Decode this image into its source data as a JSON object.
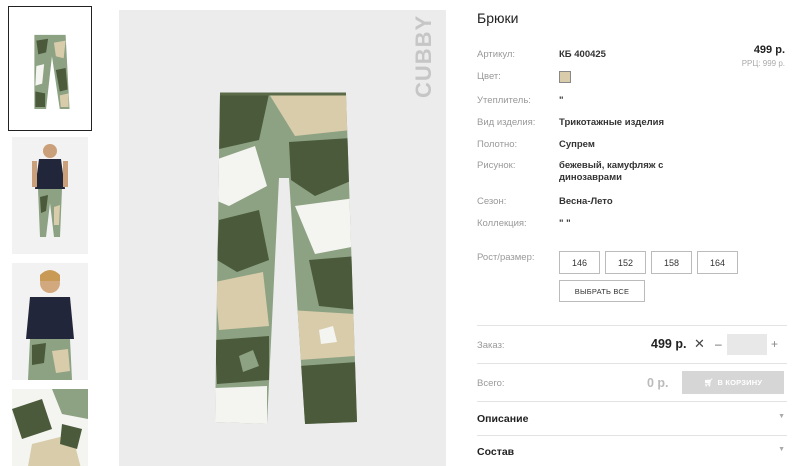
{
  "product": {
    "title": "Брюки",
    "price": "499 р.",
    "rrp": "РРЦ: 999 р.",
    "brand_watermark": "CUBBY"
  },
  "specs": {
    "article": {
      "label": "Артикул:",
      "value": "КБ 400425"
    },
    "color": {
      "label": "Цвет:",
      "swatch_color": "#d8ccaa"
    },
    "insulation": {
      "label": "Утеплитель:",
      "value": "\""
    },
    "type": {
      "label": "Вид изделия:",
      "value": "Трикотажные изделия"
    },
    "fabric": {
      "label": "Полотно:",
      "value": "Супрем"
    },
    "pattern": {
      "label": "Рисунок:",
      "value": "бежевый, камуфляж с динозаврами"
    },
    "season": {
      "label": "Сезон:",
      "value": "Весна-Лето"
    },
    "collection": {
      "label": "Коллекция:",
      "value": "\" \""
    }
  },
  "sizes": {
    "label": "Рост/размер:",
    "options": [
      "146",
      "152",
      "158",
      "164"
    ],
    "select_all": "ВЫБРАТЬ ВСЕ"
  },
  "order": {
    "label": "Заказ:",
    "price": "499 р.",
    "times": "✕",
    "minus": "–",
    "plus": "+",
    "quantity": ""
  },
  "total": {
    "label": "Всего:",
    "value": "0 р.",
    "cart_button": "В КОРЗИНУ"
  },
  "accordion": {
    "description": "Описание",
    "composition": "Состав"
  },
  "colors": {
    "camo_dark": "#4a5a3a",
    "camo_mid": "#8ca283",
    "camo_light": "#d8ccaa",
    "camo_white": "#f4f4f0"
  }
}
